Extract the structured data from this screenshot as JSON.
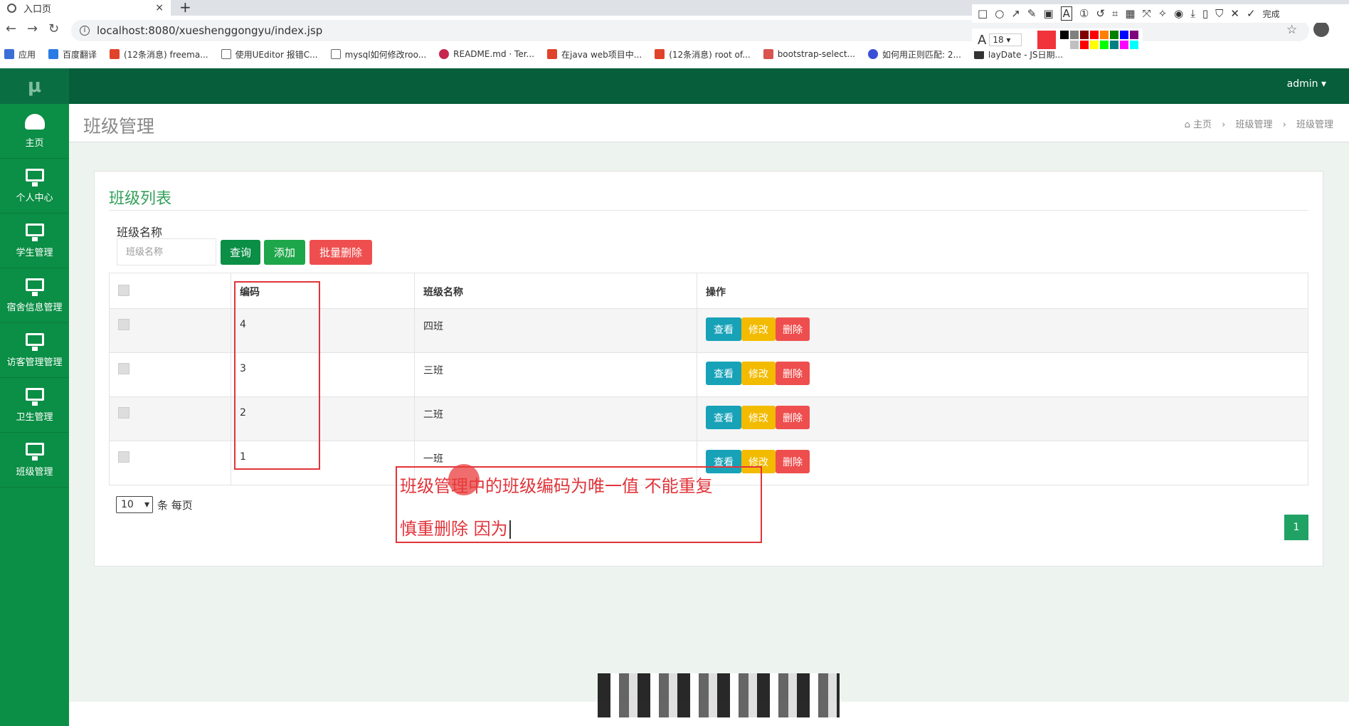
{
  "browser": {
    "tab_title": "入口页",
    "tab_close": "×",
    "new_tab": "+",
    "url": "localhost:8080/xueshenggongyu/index.jsp",
    "bookmarks": [
      "应用",
      "百度翻译",
      "(12条消息) freema...",
      "使用UEditor 报错C...",
      "mysql如何修改roo...",
      "README.md · Ter...",
      "在java web项目中...",
      "(12条消息) root of...",
      "bootstrap-select...",
      "如何用正则匹配: 2...",
      "layDate - JS日期..."
    ]
  },
  "snip_tool": {
    "done_label": "完成",
    "font_size": "18",
    "current_color": "#f0343a",
    "swatches": [
      "#000000",
      "#808080",
      "#800000",
      "#ff0000",
      "#ff8000",
      "#008000",
      "#0000ff",
      "#800080",
      "#ffffff",
      "#c0c0c0",
      "#ff0000",
      "#ffff00",
      "#00ff00",
      "#008080",
      "#ff00ff",
      "#00ffff"
    ]
  },
  "app": {
    "logo": "μ",
    "user_menu": "admin ▾",
    "sidebar": [
      {
        "label": "主页",
        "icon": "dashboard-icon"
      },
      {
        "label": "个人中心",
        "icon": "monitor-icon"
      },
      {
        "label": "学生管理",
        "icon": "monitor-icon"
      },
      {
        "label": "宿舍信息管理",
        "icon": "monitor-icon"
      },
      {
        "label": "访客管理管理",
        "icon": "monitor-icon"
      },
      {
        "label": "卫生管理",
        "icon": "monitor-icon"
      },
      {
        "label": "班级管理",
        "icon": "monitor-icon"
      }
    ],
    "page_title": "班级管理",
    "breadcrumb": {
      "home": "主页",
      "level1": "班级管理",
      "level2": "班级管理",
      "sep": "›"
    }
  },
  "panel": {
    "title": "班级列表",
    "filter_label": "班级名称",
    "filter_placeholder": "班级名称",
    "btn_query": "查询",
    "btn_add": "添加",
    "btn_batch_delete": "批量删除"
  },
  "table": {
    "headers": {
      "code": "编码",
      "name": "班级名称",
      "actions": "操作"
    },
    "rows": [
      {
        "code": "4",
        "name": "四班"
      },
      {
        "code": "3",
        "name": "三班"
      },
      {
        "code": "2",
        "name": "二班"
      },
      {
        "code": "1",
        "name": "一班"
      }
    ],
    "actions": {
      "view": "查看",
      "edit": "修改",
      "delete": "删除"
    }
  },
  "pagination": {
    "page_size": "10",
    "per_page_suffix": "条 每页",
    "current_page": "1"
  },
  "annotation": {
    "line1": "班级管理中的班级编码为唯一值 不能重复",
    "line2": "慎重删除 因为",
    "color": "#e0343a"
  }
}
